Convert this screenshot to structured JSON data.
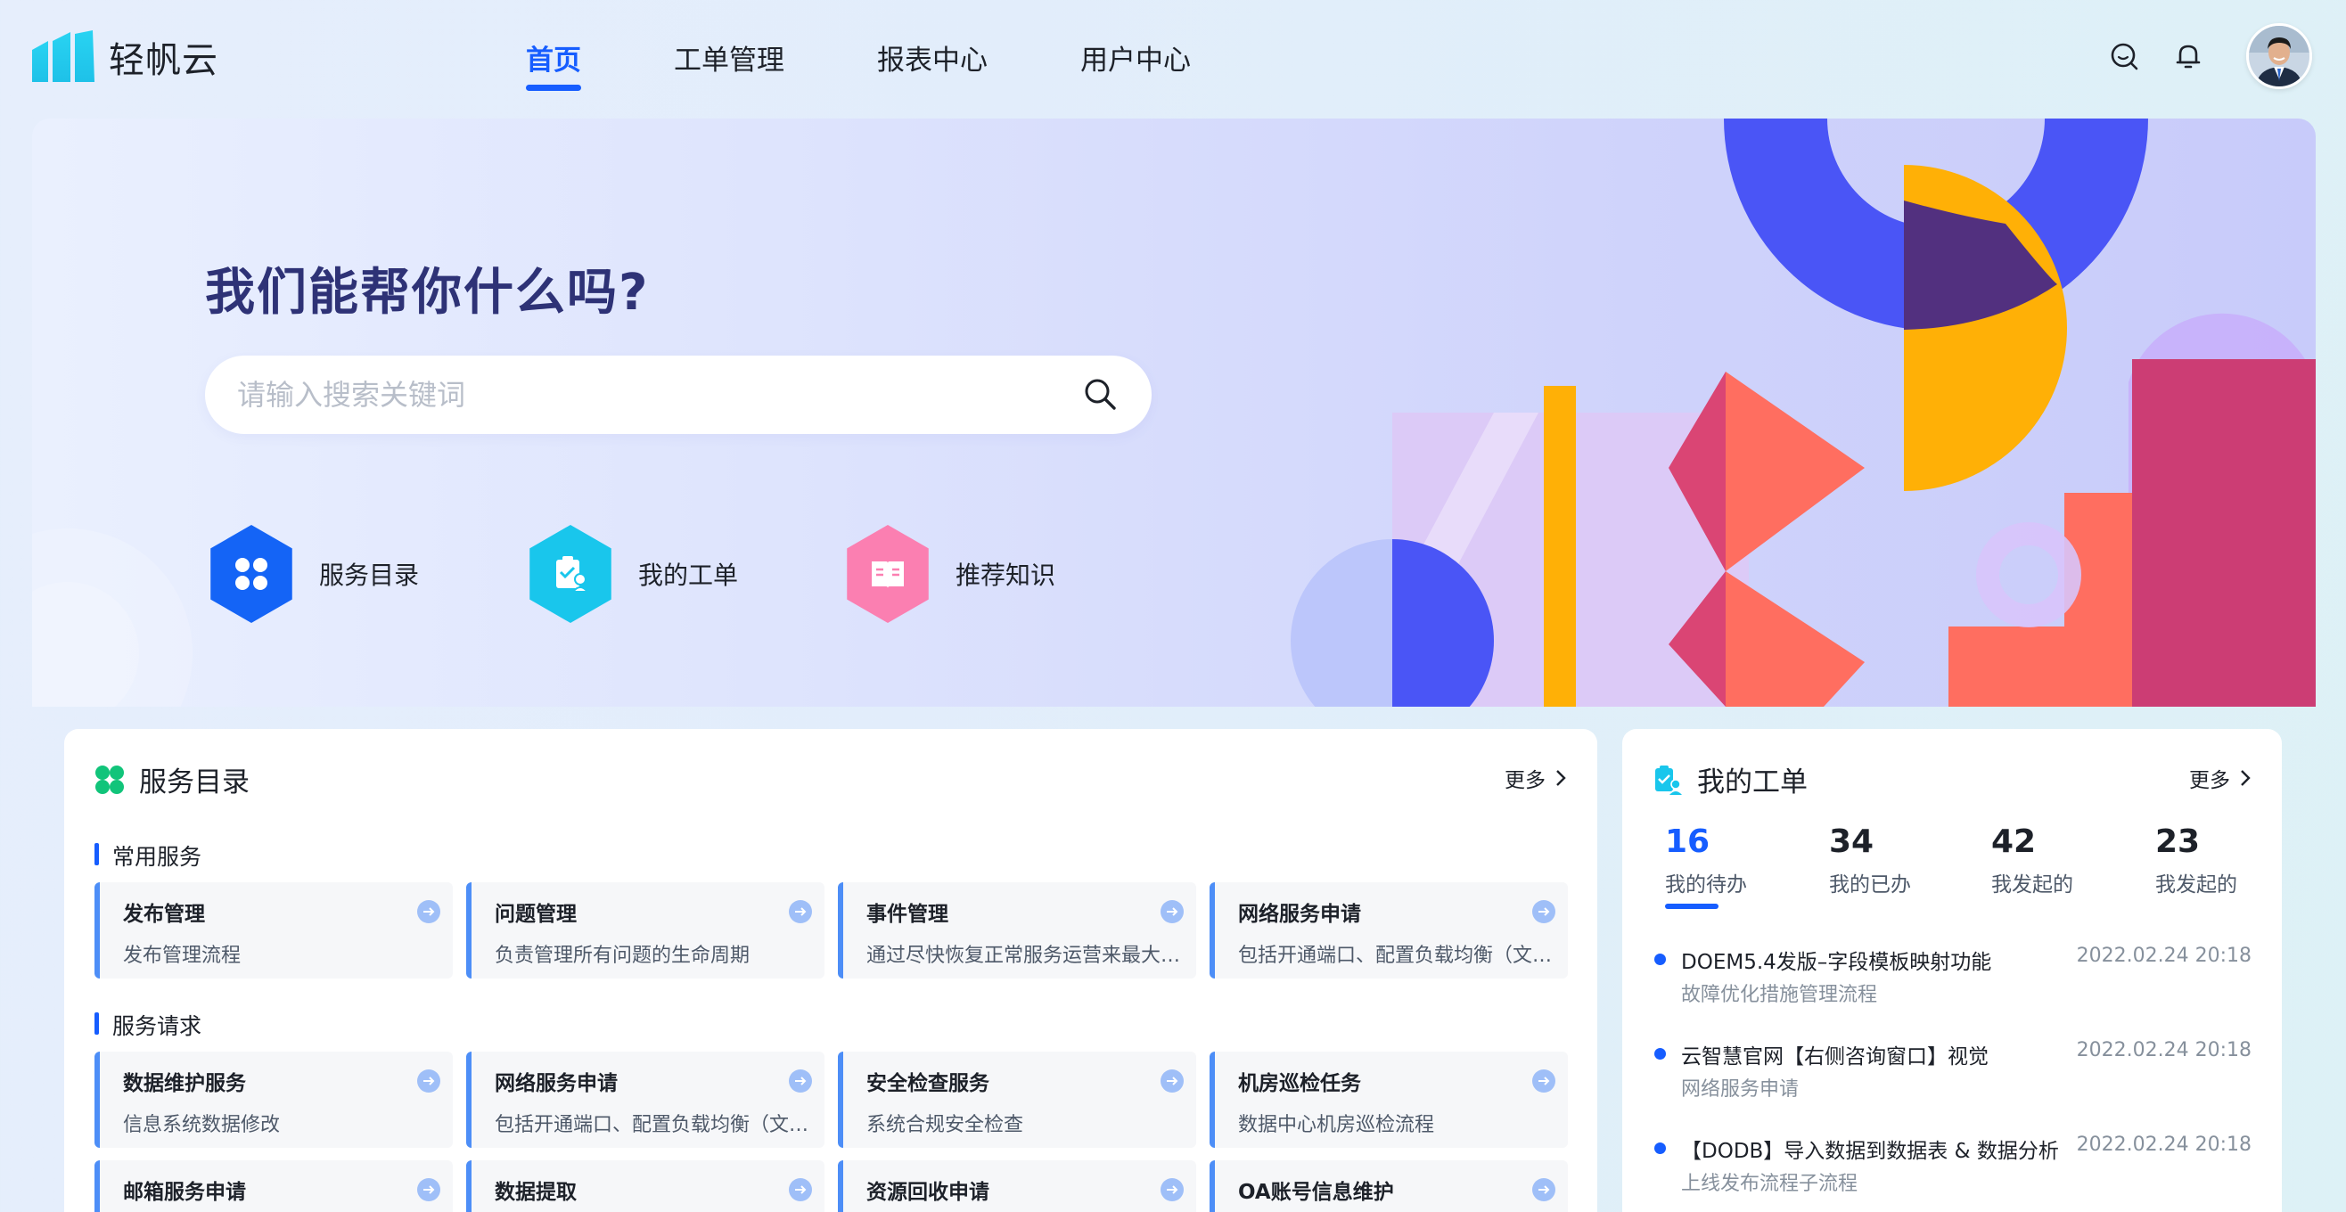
{
  "brand": {
    "name": "轻帆云"
  },
  "nav": [
    {
      "label": "首页",
      "active": true
    },
    {
      "label": "工单管理"
    },
    {
      "label": "报表中心"
    },
    {
      "label": "用户中心"
    }
  ],
  "header_icons": [
    "search-icon",
    "bell-icon"
  ],
  "hero": {
    "title": "我们能帮你什么吗?",
    "search_placeholder": "请输入搜索关键词",
    "quick_links": [
      {
        "label": "服务目录",
        "icon": "grid-icon",
        "color": "#1464f6"
      },
      {
        "label": "我的工单",
        "icon": "clipboard-user-icon",
        "color": "#19c6ec"
      },
      {
        "label": "推荐知识",
        "icon": "book-icon",
        "color": "#fb7fb1"
      }
    ]
  },
  "catalog": {
    "title": "服务目录",
    "more": "更多",
    "sections": [
      {
        "label": "常用服务",
        "cards": [
          {
            "title": "发布管理",
            "desc": "发布管理流程"
          },
          {
            "title": "问题管理",
            "desc": "负责管理所有问题的生命周期"
          },
          {
            "title": "事件管理",
            "desc": "通过尽快恢复正常服务运营来最大…"
          },
          {
            "title": "网络服务申请",
            "desc": "包括开通端口、配置负载均衡（文…"
          }
        ]
      },
      {
        "label": "服务请求",
        "cards": [
          {
            "title": "数据维护服务",
            "desc": "信息系统数据修改"
          },
          {
            "title": "网络服务申请",
            "desc": "包括开通端口、配置负载均衡（文…"
          },
          {
            "title": "安全检查服务",
            "desc": "系统合规安全检查"
          },
          {
            "title": "机房巡检任务",
            "desc": "数据中心机房巡检流程"
          },
          {
            "title": "邮箱服务申请",
            "desc": ""
          },
          {
            "title": "数据提取",
            "desc": ""
          },
          {
            "title": "资源回收申请",
            "desc": ""
          },
          {
            "title": "OA账号信息维护",
            "desc": ""
          }
        ]
      }
    ]
  },
  "orders": {
    "title": "我的工单",
    "more": "更多",
    "stats": [
      {
        "value": "16",
        "label": "我的待办",
        "active": true
      },
      {
        "value": "34",
        "label": "我的已办"
      },
      {
        "value": "42",
        "label": "我发起的"
      },
      {
        "value": "23",
        "label": "我发起的"
      }
    ],
    "items": [
      {
        "title": "DOEM5.4发版–字段模板映射功能",
        "sub": "故障优化措施管理流程",
        "time": "2022.02.24 20:18"
      },
      {
        "title": "云智慧官网【右侧咨询窗口】视觉",
        "sub": "网络服务申请",
        "time": "2022.02.24 20:18"
      },
      {
        "title": "【DODB】导入数据到数据表 & 数据分析",
        "sub": "上线发布流程子流程",
        "time": "2022.02.24 20:18"
      }
    ]
  }
}
